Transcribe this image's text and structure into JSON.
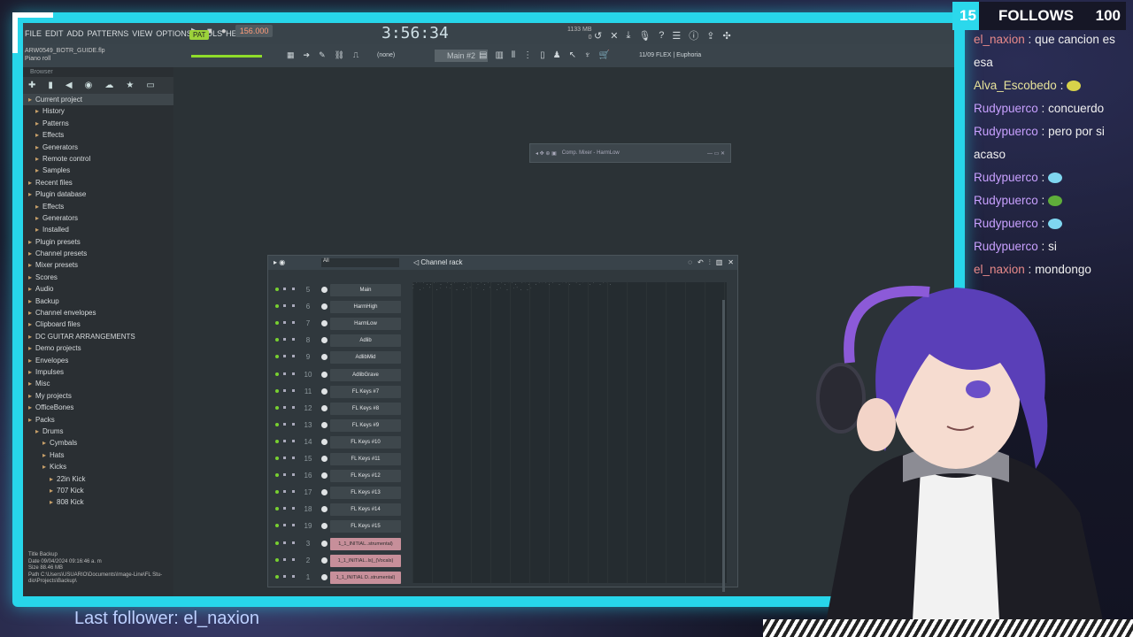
{
  "fl": {
    "menu": [
      "FILE",
      "EDIT",
      "ADD",
      "PATTERNS",
      "VIEW",
      "OPTIONS",
      "TOOLS",
      "HELP"
    ],
    "pat_label": "PAT",
    "tempo": "156.000",
    "time": "3:56:34",
    "cpu": [
      "1133 MB",
      "0"
    ],
    "file_name": "ARW0549_BOTR_GUIDE.flp",
    "mode_label": "Piano roll",
    "none_label": "(none)",
    "pattern": "Main #2",
    "flex_label": "11/09  FLEX | Euphoria"
  },
  "browser": {
    "header": "Browser",
    "items": [
      {
        "label": "Current project",
        "icon": "folder",
        "indent": 0
      },
      {
        "label": "History",
        "indent": 1
      },
      {
        "label": "Patterns",
        "indent": 1
      },
      {
        "label": "Effects",
        "indent": 1
      },
      {
        "label": "Generators",
        "indent": 1
      },
      {
        "label": "Remote control",
        "indent": 1
      },
      {
        "label": "Samples",
        "indent": 1
      },
      {
        "label": "Recent files",
        "indent": 0
      },
      {
        "label": "Plugin database",
        "indent": 0
      },
      {
        "label": "Effects",
        "indent": 1
      },
      {
        "label": "Generators",
        "indent": 1
      },
      {
        "label": "Installed",
        "indent": 1
      },
      {
        "label": "Plugin presets",
        "indent": 0
      },
      {
        "label": "Channel presets",
        "indent": 0
      },
      {
        "label": "Mixer presets",
        "indent": 0
      },
      {
        "label": "Scores",
        "indent": 0
      },
      {
        "label": "Audio",
        "indent": 0
      },
      {
        "label": "Backup",
        "indent": 0
      },
      {
        "label": "Channel envelopes",
        "indent": 0
      },
      {
        "label": "Clipboard files",
        "indent": 0
      },
      {
        "label": "DC GUITAR ARRANGEMENTS",
        "indent": 0
      },
      {
        "label": "Demo projects",
        "indent": 0
      },
      {
        "label": "Envelopes",
        "indent": 0
      },
      {
        "label": "Impulses",
        "indent": 0
      },
      {
        "label": "Misc",
        "indent": 0
      },
      {
        "label": "My projects",
        "indent": 0
      },
      {
        "label": "OfficeBones",
        "indent": 0
      },
      {
        "label": "Packs",
        "indent": 0
      },
      {
        "label": "Drums",
        "indent": 1
      },
      {
        "label": "Cymbals",
        "indent": 2
      },
      {
        "label": "Hats",
        "indent": 2
      },
      {
        "label": "Kicks",
        "indent": 2
      },
      {
        "label": "22in Kick",
        "indent": 3
      },
      {
        "label": "707 Kick",
        "indent": 3
      },
      {
        "label": "808 Kick",
        "indent": 3
      }
    ],
    "info": [
      "Title    Backup",
      "Date    09/04/2024 09:16:46 a. m",
      "Size    88.46 MB",
      "Path    C:\\Users\\USUARIO\\Documents\\Image-Line\\FL Stu-",
      "          dio\\Projects\\Backup\\"
    ]
  },
  "mixer": {
    "label": "Comp.  Mixer - HarmLow"
  },
  "rack": {
    "title": "Channel rack",
    "filter": "All",
    "channels": [
      {
        "num": "5",
        "name": "Main",
        "audio": false
      },
      {
        "num": "6",
        "name": "HarmHigh",
        "audio": false
      },
      {
        "num": "7",
        "name": "HarmLow",
        "audio": false
      },
      {
        "num": "8",
        "name": "Adlib",
        "audio": false
      },
      {
        "num": "9",
        "name": "AdlibMid",
        "audio": false
      },
      {
        "num": "10",
        "name": "AdlibGrave",
        "audio": false
      },
      {
        "num": "11",
        "name": "FL Keys #7",
        "audio": false
      },
      {
        "num": "12",
        "name": "FL Keys #8",
        "audio": false
      },
      {
        "num": "13",
        "name": "FL Keys #9",
        "audio": false
      },
      {
        "num": "14",
        "name": "FL Keys #10",
        "audio": false
      },
      {
        "num": "15",
        "name": "FL Keys #11",
        "audio": false
      },
      {
        "num": "16",
        "name": "FL Keys #12",
        "audio": false
      },
      {
        "num": "17",
        "name": "FL Keys #13",
        "audio": false
      },
      {
        "num": "18",
        "name": "FL Keys #14",
        "audio": false
      },
      {
        "num": "19",
        "name": "FL Keys #15",
        "audio": false
      },
      {
        "num": "3",
        "name": "1_1_INITIAL..strumental)",
        "audio": true
      },
      {
        "num": "2",
        "name": "1_1_INITIAL..ls)_(Vocals)",
        "audio": true
      },
      {
        "num": "1",
        "name": "1_1_INITIAL D..strumental)",
        "audio": true
      }
    ]
  },
  "chat": [
    {
      "user": "el_naxion",
      "text": "que cancion es esa",
      "color": "#e98a8a"
    },
    {
      "user": "Alva_Escobedo",
      "text": "",
      "emote": "#d8d24a",
      "color": "#e7e39a"
    },
    {
      "user": "Rudypuerco",
      "text": "concuerdo",
      "color": "#c8a0ff"
    },
    {
      "user": "Rudypuerco",
      "text": "pero por si acaso",
      "color": "#c8a0ff"
    },
    {
      "user": "Rudypuerco",
      "text": "",
      "emote": "#7fd6f0",
      "color": "#c8a0ff"
    },
    {
      "user": "Rudypuerco",
      "text": "",
      "emote": "#5fae3a",
      "color": "#c8a0ff"
    },
    {
      "user": "Rudypuerco",
      "text": "",
      "emote": "#7fd6f0",
      "color": "#c8a0ff"
    },
    {
      "user": "Rudypuerco",
      "text": "si",
      "color": "#c8a0ff"
    },
    {
      "user": "el_naxion",
      "text": "mondongo",
      "color": "#e98a8a"
    }
  ],
  "follows": {
    "current": "15",
    "label": "FOLLOWS",
    "goal": "100"
  },
  "last_follower": "Last follower: el_naxion",
  "colors": {
    "accent": "#27d6ea",
    "avatar_hair": "#5a3fb8"
  }
}
